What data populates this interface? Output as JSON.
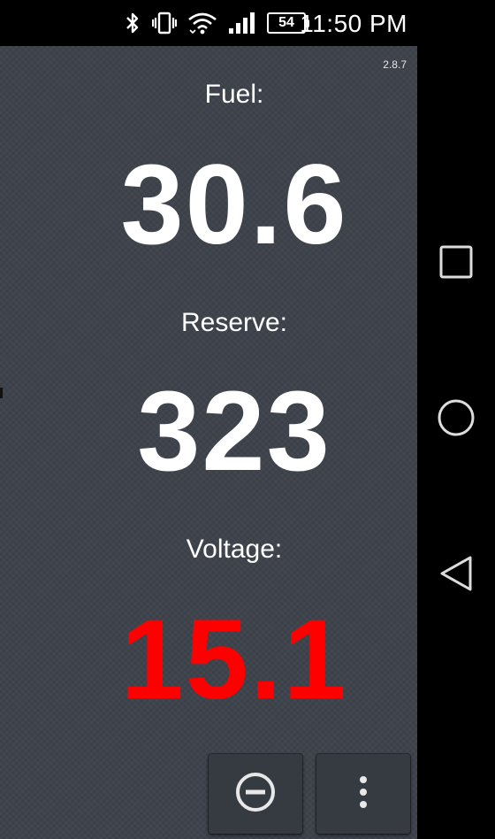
{
  "status_bar": {
    "battery_level": "54",
    "time": "11:50 PM",
    "icons": [
      "bluetooth-icon",
      "vibrate-icon",
      "wifi-icon",
      "signal-icon",
      "battery-icon"
    ]
  },
  "app": {
    "version": "2.8.7",
    "metrics": [
      {
        "label": "Fuel:",
        "value": "30.6",
        "color": "#ffffff"
      },
      {
        "label": "Reserve:",
        "value": "323",
        "color": "#ffffff"
      },
      {
        "label": "Voltage:",
        "value": "15.1",
        "color": "#ff0000"
      }
    ],
    "buttons": [
      "minus-circle-icon",
      "more-vert-icon"
    ]
  },
  "nav_bar": {
    "icons": [
      "recents-icon",
      "home-icon",
      "back-icon"
    ]
  },
  "colors": {
    "background": "#3e434c",
    "value_normal": "#ffffff",
    "value_alert": "#ff0000"
  }
}
